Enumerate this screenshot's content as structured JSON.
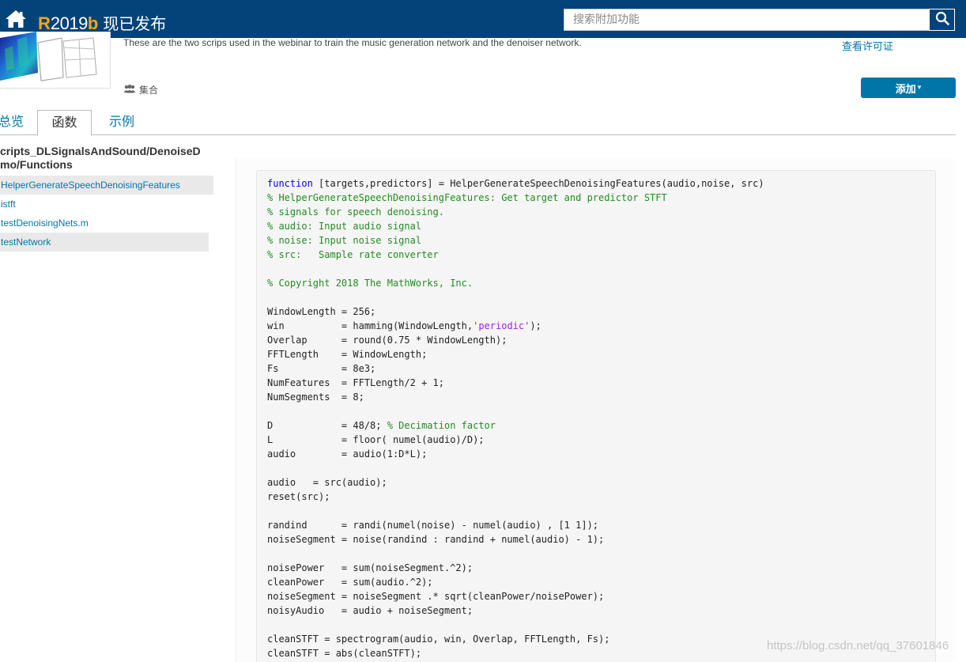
{
  "topbar": {
    "release_r": "R",
    "release_year": "2019",
    "release_b": "b",
    "release_text": "现已发布",
    "search_placeholder": "搜索附加功能",
    "colors": {
      "bar": "#04437a",
      "accent": "#f7a51d"
    }
  },
  "header": {
    "summary": "These are the two scrips used in the webinar to train the music generation network and the denoiser network.",
    "license_link": "查看许可证",
    "collection_label": "集合",
    "add_button": "添加",
    "add_caret": "▾"
  },
  "tabs": [
    {
      "label": "总览"
    },
    {
      "label": "函数"
    },
    {
      "label": "示例"
    }
  ],
  "sidebar": {
    "folder_title_line1": "cripts_DLSignalsAndSound/DenoiseD",
    "folder_title_line2": "mo/Functions",
    "files": [
      {
        "label": "HelperGenerateSpeechDenoisingFeatures"
      },
      {
        "label": "istft"
      },
      {
        "label": "testDenoisingNets.m"
      },
      {
        "label": "testNetwork"
      }
    ]
  },
  "code": {
    "lines": [
      [
        {
          "t": "function",
          "c": "kw"
        },
        {
          "t": " [targets,predictors] = HelperGenerateSpeechDenoisingFeatures(audio,noise, src)"
        }
      ],
      [
        {
          "t": "% HelperGenerateSpeechDenoisingFeatures: Get target and predictor STFT",
          "c": "cm"
        }
      ],
      [
        {
          "t": "% signals for speech denoising.",
          "c": "cm"
        }
      ],
      [
        {
          "t": "% audio: Input audio signal",
          "c": "cm"
        }
      ],
      [
        {
          "t": "% noise: Input noise signal",
          "c": "cm"
        }
      ],
      [
        {
          "t": "% src:   Sample rate converter",
          "c": "cm"
        }
      ],
      [],
      [
        {
          "t": "% Copyright 2018 The MathWorks, Inc.",
          "c": "cm"
        }
      ],
      [],
      [
        {
          "t": "WindowLength = 256;"
        }
      ],
      [
        {
          "t": "win          = hamming(WindowLength,"
        },
        {
          "t": "'periodic'",
          "c": "st"
        },
        {
          "t": ");"
        }
      ],
      [
        {
          "t": "Overlap      = round(0.75 * WindowLength);"
        }
      ],
      [
        {
          "t": "FFTLength    = WindowLength;"
        }
      ],
      [
        {
          "t": "Fs           = 8e3;"
        }
      ],
      [
        {
          "t": "NumFeatures  = FFTLength/2 + 1;"
        }
      ],
      [
        {
          "t": "NumSegments  = 8;"
        }
      ],
      [],
      [
        {
          "t": "D            = 48/8; "
        },
        {
          "t": "% Decimation factor",
          "c": "cm"
        }
      ],
      [
        {
          "t": "L            = floor( numel(audio)/D);"
        }
      ],
      [
        {
          "t": "audio        = audio(1:D*L);"
        }
      ],
      [],
      [
        {
          "t": "audio   = src(audio);"
        }
      ],
      [
        {
          "t": "reset(src);"
        }
      ],
      [],
      [
        {
          "t": "randind      = randi(numel(noise) - numel(audio) , [1 1]);"
        }
      ],
      [
        {
          "t": "noiseSegment = noise(randind : randind + numel(audio) - 1);"
        }
      ],
      [],
      [
        {
          "t": "noisePower   = sum(noiseSegment.^2);"
        }
      ],
      [
        {
          "t": "cleanPower   = sum(audio.^2);"
        }
      ],
      [
        {
          "t": "noiseSegment = noiseSegment .* sqrt(cleanPower/noisePower);"
        }
      ],
      [
        {
          "t": "noisyAudio   = audio + noiseSegment;"
        }
      ],
      [],
      [
        {
          "t": "cleanSTFT = spectrogram(audio, win, Overlap, FFTLength, Fs);"
        }
      ],
      [
        {
          "t": "cleanSTFT = abs(cleanSTFT);"
        }
      ]
    ]
  },
  "watermark": "https://blog.csdn.net/qq_37601846"
}
